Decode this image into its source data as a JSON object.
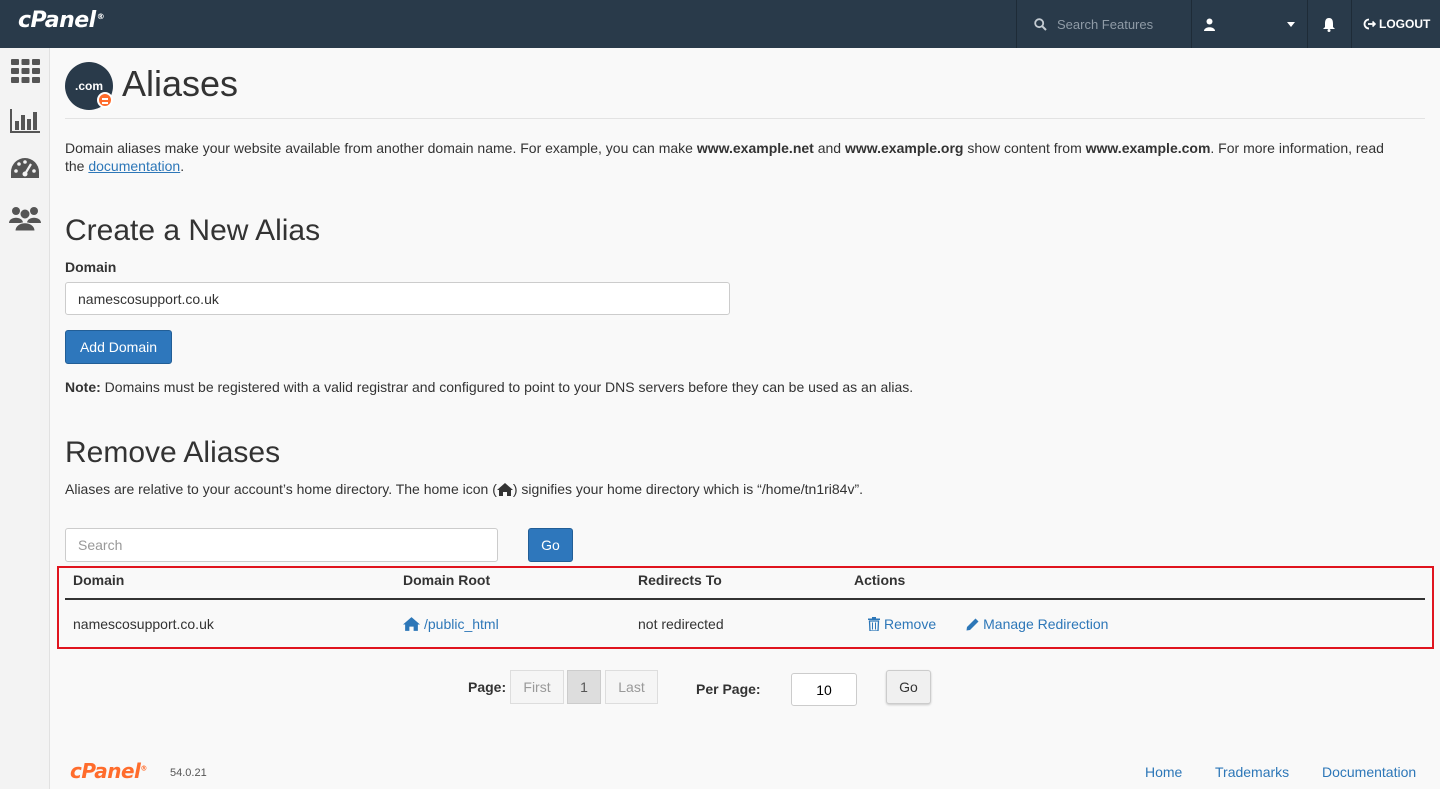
{
  "topbar": {
    "logo": "cPanel",
    "search_placeholder": "Search Features",
    "logout_label": "LOGOUT"
  },
  "sidebar": {
    "items": [
      {
        "icon": "grid-icon"
      },
      {
        "icon": "stats-chart-icon"
      },
      {
        "icon": "dashboard-gauge-icon"
      },
      {
        "icon": "users-icon"
      }
    ]
  },
  "page": {
    "icon_text": ".com",
    "title": "Aliases",
    "intro": {
      "t1": "Domain aliases make your website available from another domain name. For example, you can make ",
      "b1": "www.example.net",
      "t2": " and ",
      "b2": "www.example.org",
      "t3": " show content from ",
      "b3": "www.example.com",
      "t4": ". For more information, read the ",
      "link": "documentation",
      "t5": "."
    }
  },
  "create": {
    "heading": "Create a New Alias",
    "domain_label": "Domain",
    "domain_value": "namescosupport.co.uk",
    "add_button": "Add Domain",
    "note_bold": "Note:",
    "note_text": " Domains must be registered with a valid registrar and configured to point to your DNS servers before they can be used as an alias."
  },
  "remove": {
    "heading": "Remove Aliases",
    "desc_before": "Aliases are relative to your account’s home directory. The home icon (",
    "desc_after": ") signifies your home directory which is “/home/tn1ri84v”.",
    "search_placeholder": "Search",
    "go_label": "Go",
    "columns": [
      "Domain",
      "Domain Root",
      "Redirects To",
      "Actions"
    ],
    "rows": [
      {
        "domain": "namescosupport.co.uk",
        "root": "/public_html",
        "redirects": "not redirected",
        "remove_label": "Remove",
        "manage_label": "Manage Redirection"
      }
    ]
  },
  "pagination": {
    "page_label": "Page:",
    "first": "First",
    "current": "1",
    "last": "Last",
    "per_page_label": "Per Page:",
    "per_page_value": "10",
    "go_label": "Go"
  },
  "footer": {
    "logo": "cPanel",
    "version": "54.0.21",
    "links": [
      "Home",
      "Trademarks",
      "Documentation"
    ]
  },
  "colors": {
    "topbar_bg": "#293a4a",
    "primary": "#2e77bc",
    "link": "#2d77b8",
    "brand_orange": "#ff6c2c",
    "highlight": "#e0141e"
  }
}
